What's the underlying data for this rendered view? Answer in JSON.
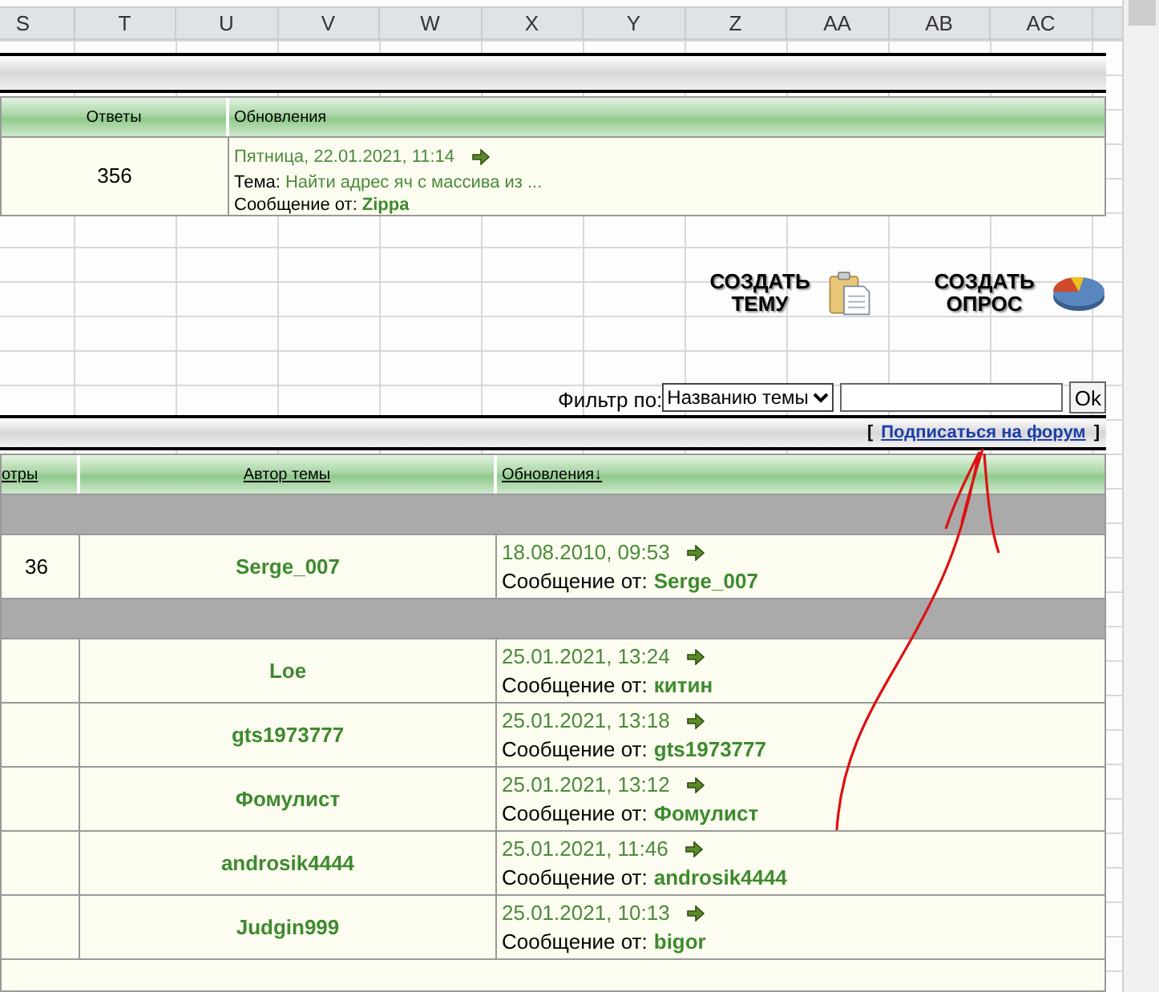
{
  "spreadsheet": {
    "columns": [
      "S",
      "T",
      "U",
      "V",
      "W",
      "X",
      "Y",
      "Z",
      "AA",
      "AB",
      "AC"
    ]
  },
  "section_table": {
    "columns": [
      "Ответы",
      "Обновления"
    ],
    "rows": [
      {
        "replies": "356",
        "date": "Пятница, 22.01.2021, 11:14",
        "topic_label": "Тема:",
        "topic": "Найти адрес яч с массива из ...",
        "from_label": "Сообщение от:",
        "author": "Zippa"
      }
    ]
  },
  "actions": [
    {
      "kind": "topic",
      "label": "СОЗДАТЬ ТЕМУ"
    },
    {
      "kind": "poll",
      "label": "СОЗДАТЬ ОПРОС"
    }
  ],
  "filter": {
    "label": "Фильтр по:",
    "select": "Названию темы",
    "button": "Ok"
  },
  "subscribe": {
    "open": "[",
    "link": "Подписаться на форум",
    "close": "]"
  },
  "topics": {
    "columns": [
      "отры",
      "Автор темы",
      "Обновления↓"
    ],
    "groups": [
      {
        "rows": [
          {
            "column_1": "36",
            "author": "Serge_007",
            "date": "18.08.2010, 09:53",
            "from_label": "Сообщение от:",
            "last_author": "Serge_007"
          }
        ]
      },
      {
        "rows": [
          {
            "author": "Loe",
            "date": "25.01.2021, 13:24",
            "from_label": "Сообщение от:",
            "last_author": "китин"
          },
          {
            "author": "gts1973777",
            "date": "25.01.2021, 13:18",
            "from_label": "Сообщение от:",
            "last_author": "gts1973777"
          },
          {
            "author": "Фомулист",
            "date": "25.01.2021, 13:12",
            "from_label": "Сообщение от:",
            "last_author": "Фомулист"
          },
          {
            "author": "androsik4444",
            "date": "25.01.2021, 11:46",
            "from_label": "Сообщение от:",
            "last_author": "androsik4444"
          },
          {
            "author": "Judgin999",
            "date": "25.01.2021, 10:13",
            "from_label": "Сообщение от:",
            "last_author": "bigor"
          }
        ]
      }
    ]
  }
}
